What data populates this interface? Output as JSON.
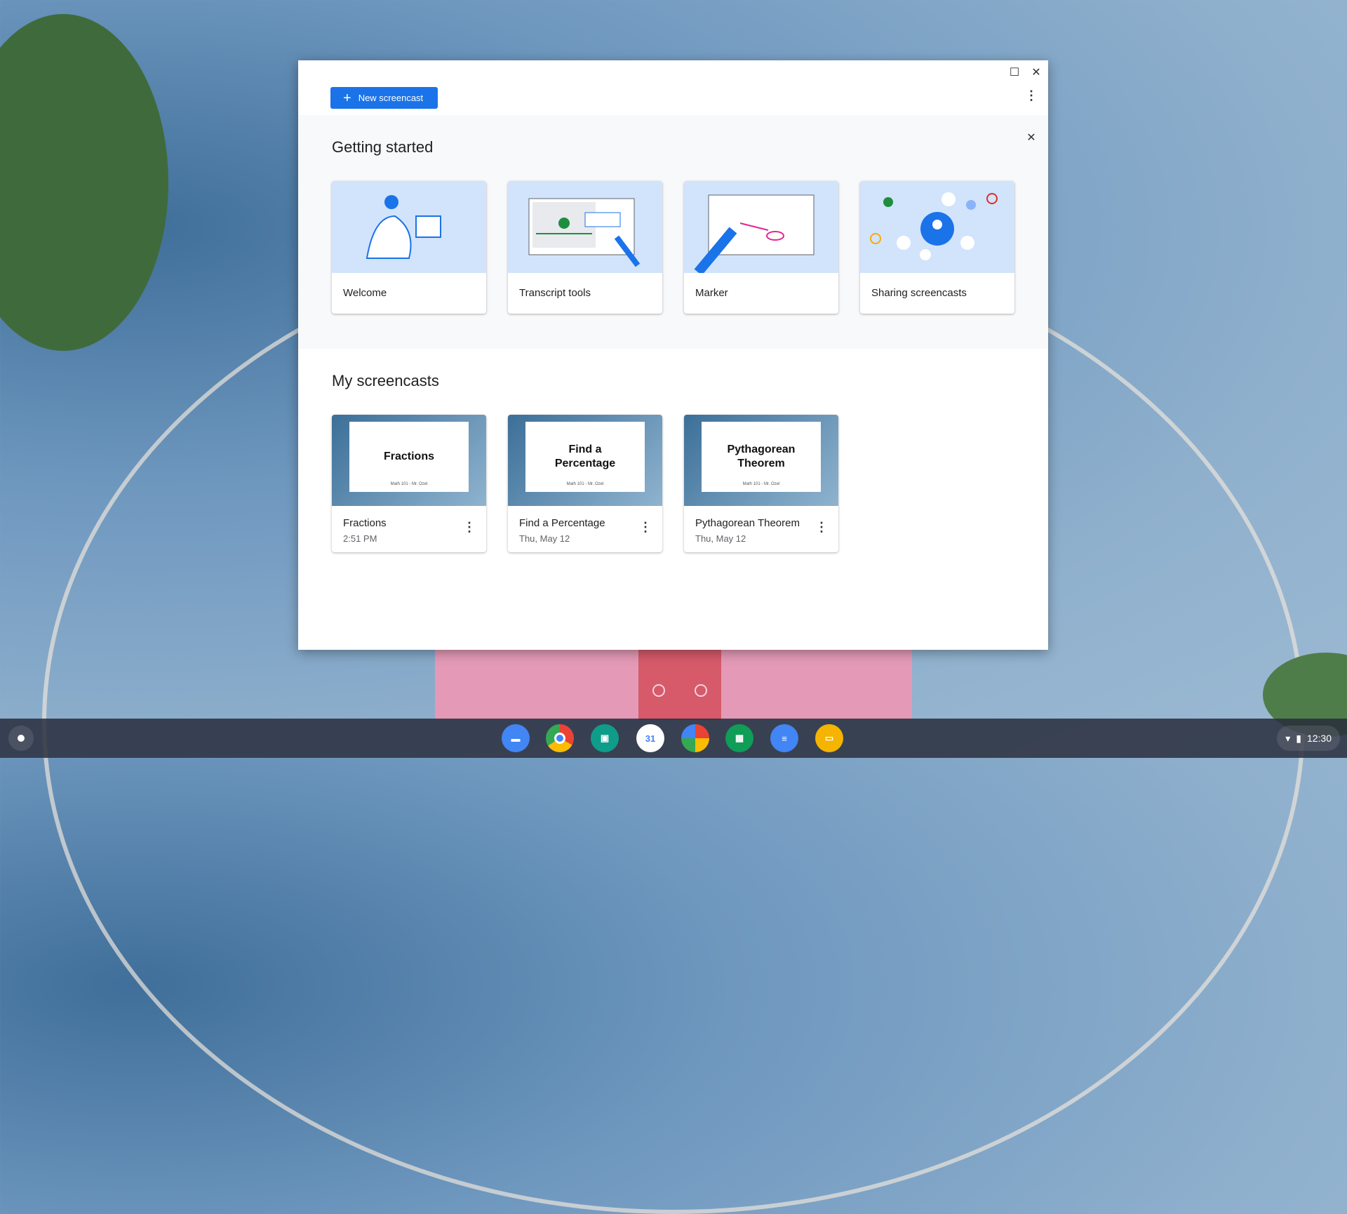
{
  "window": {
    "maximize_icon": "maximize-icon",
    "close_icon": "close-icon"
  },
  "toolbar": {
    "new_label": "New screencast",
    "more_icon": "more-vert-icon"
  },
  "getting_started": {
    "title": "Getting started",
    "cards": [
      {
        "label": "Welcome"
      },
      {
        "label": "Transcript tools"
      },
      {
        "label": "Marker"
      },
      {
        "label": "Sharing screencasts"
      }
    ]
  },
  "my_screencasts": {
    "title": "My screencasts",
    "items": [
      {
        "title": "Fractions",
        "slide_title": "Fractions",
        "slide_subtitle": "Math 101 - Mr. Ozel",
        "date": "2:51 PM"
      },
      {
        "title": "Find a Percentage",
        "slide_title": "Find a Percentage",
        "slide_subtitle": "Math 101 - Mr. Ozel",
        "date": "Thu, May 12"
      },
      {
        "title": "Pythagorean Theorem",
        "slide_title": "Pythagorean Theorem",
        "slide_subtitle": "Math 101 - Mr. Ozel",
        "date": "Thu, May 12"
      }
    ]
  },
  "shelf": {
    "apps": [
      "Files",
      "Chrome",
      "Classroom",
      "Calendar",
      "Photos",
      "Sheets",
      "Docs",
      "Slides"
    ],
    "calendar_day": "31",
    "clock": "12:30"
  }
}
